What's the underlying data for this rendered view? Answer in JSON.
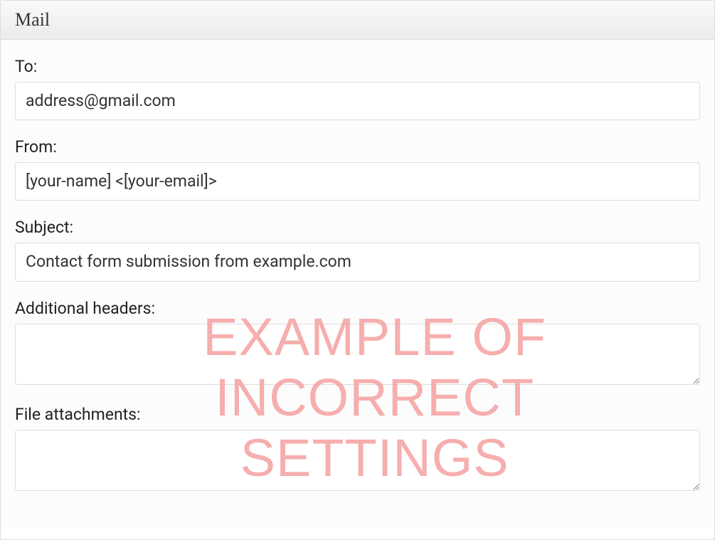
{
  "panel": {
    "title": "Mail"
  },
  "fields": {
    "to": {
      "label": "To:",
      "value": "address@gmail.com"
    },
    "from": {
      "label": "From:",
      "value": "[your-name] <[your-email]>"
    },
    "subject": {
      "label": "Subject:",
      "value": "Contact form submission from example.com"
    },
    "additional_headers": {
      "label": "Additional headers:",
      "value": ""
    },
    "file_attachments": {
      "label": "File attachments:",
      "value": ""
    }
  },
  "watermark": {
    "line1": "EXAMPLE OF",
    "line2": "INCORRECT",
    "line3": "SETTINGS"
  }
}
